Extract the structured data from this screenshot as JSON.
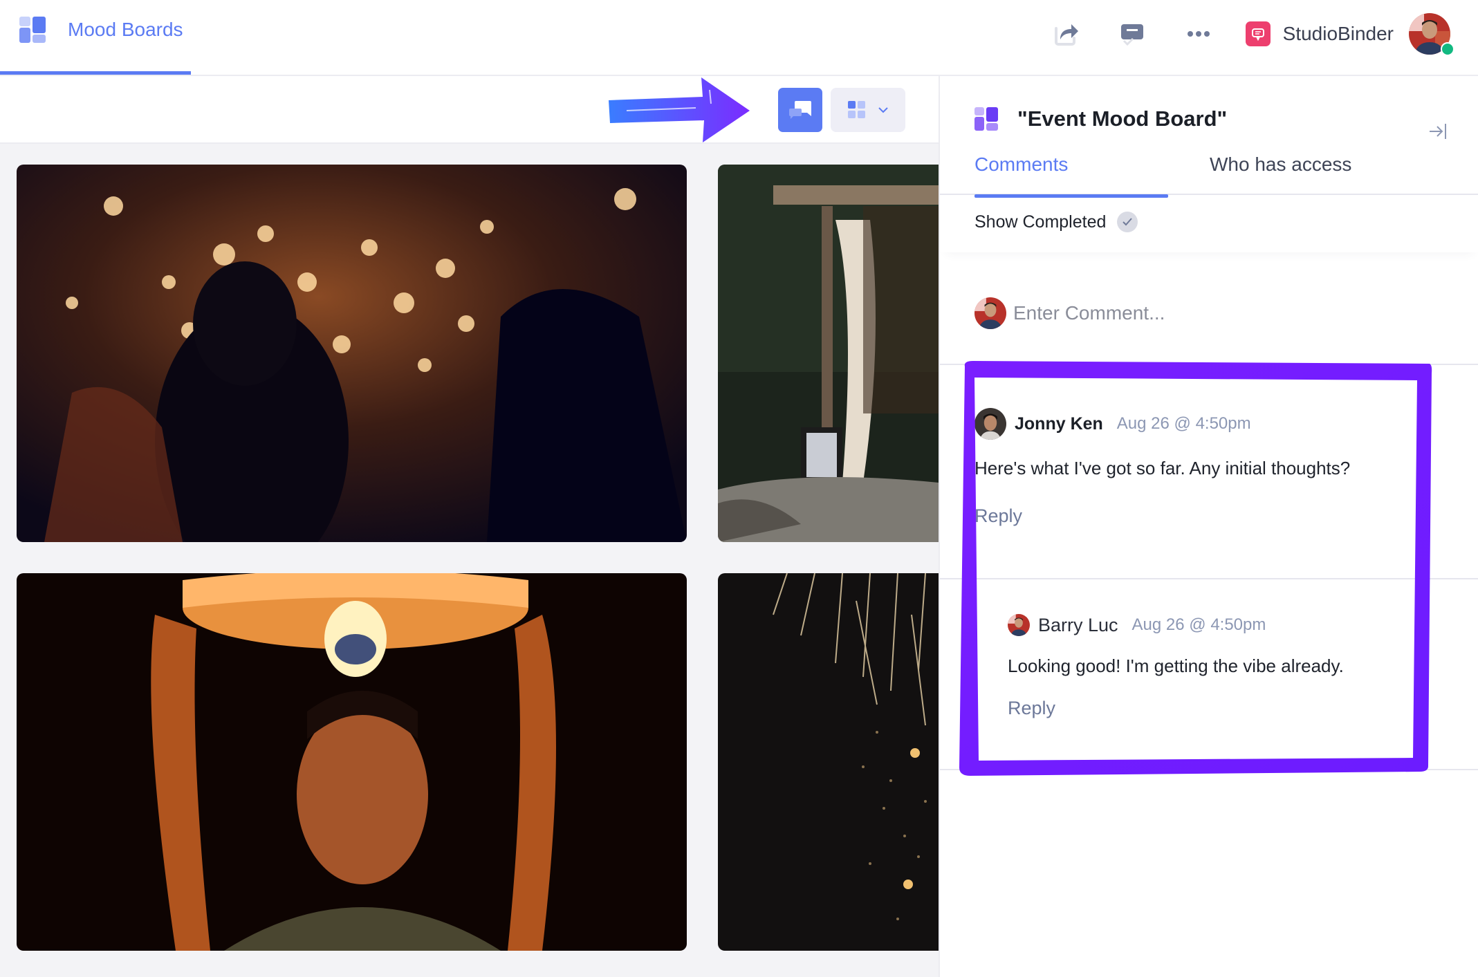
{
  "header": {
    "app_section": "Mood Boards",
    "account_name": "StudioBinder",
    "icons": [
      "share-icon",
      "comments-check-icon",
      "more-icon",
      "studiobinder-logo-icon",
      "user-avatar"
    ],
    "online_status_color": "#12b981"
  },
  "toolbar": {
    "comments_toggle_icon": "comments-icon",
    "view_toggle_icon": "grid-view-icon",
    "view_dropdown_icon": "chevron-down-icon",
    "annotation": "arrow-pointing-to-comments-button"
  },
  "board": {
    "images": [
      {
        "name": "sparklers-crowd-night"
      },
      {
        "name": "pergola-evening-patio"
      },
      {
        "name": "man-holding-sky-lantern"
      },
      {
        "name": "fireworks-sparks-night"
      }
    ]
  },
  "panel": {
    "title": "\"Event Mood Board\"",
    "tabs": [
      {
        "label": "Comments",
        "active": true
      },
      {
        "label": "Who has access",
        "active": false
      }
    ],
    "show_completed_label": "Show Completed",
    "show_completed_checked": true,
    "comment_placeholder": "Enter Comment...",
    "comments": [
      {
        "author": "Jonny Ken",
        "time": "Aug 26 @ 4:50pm",
        "body": "Here's what I've got so far. Any initial thoughts?",
        "reply_label": "Reply"
      },
      {
        "author": "Barry Luc",
        "time": "Aug 26 @ 4:50pm",
        "body": "Looking good! I'm getting the vibe already.",
        "reply_label": "Reply"
      }
    ]
  },
  "colors": {
    "accent": "#5b7bf3",
    "brand_pink": "#ed3f6e",
    "highlight_purple": "#8a10ff",
    "text_muted": "#8c97b3"
  }
}
